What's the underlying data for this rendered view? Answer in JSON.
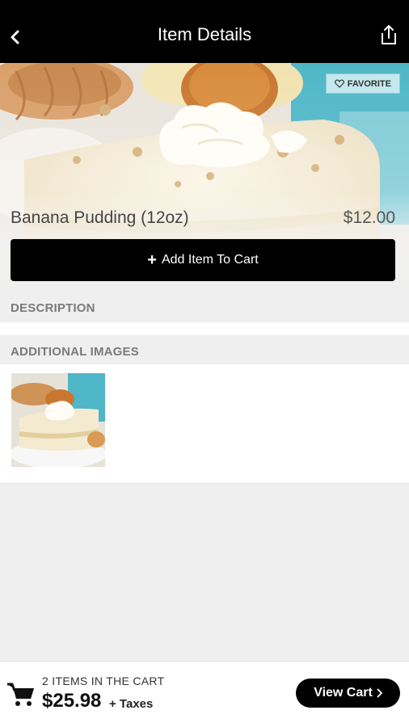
{
  "header": {
    "title": "Item Details",
    "back_icon": "chevron-left-icon",
    "share_icon": "share-icon"
  },
  "hero": {
    "favorite_label": "FAVORITE",
    "favorite_icon": "heart-outline-icon"
  },
  "item": {
    "name": "Banana Pudding (12oz)",
    "price": "$12.00",
    "add_label": "Add Item To Cart"
  },
  "sections": {
    "description": "DESCRIPTION",
    "additional_images": "ADDITIONAL IMAGES"
  },
  "cart": {
    "items_text": "2 ITEMS IN THE CART",
    "total": "$25.98",
    "taxes": "+ Taxes",
    "view_label": "View Cart",
    "cart_icon": "shopping-cart-icon"
  },
  "colors": {
    "bar": "#000000",
    "background": "#efefef",
    "accent_teal": "#4fb7c7"
  }
}
